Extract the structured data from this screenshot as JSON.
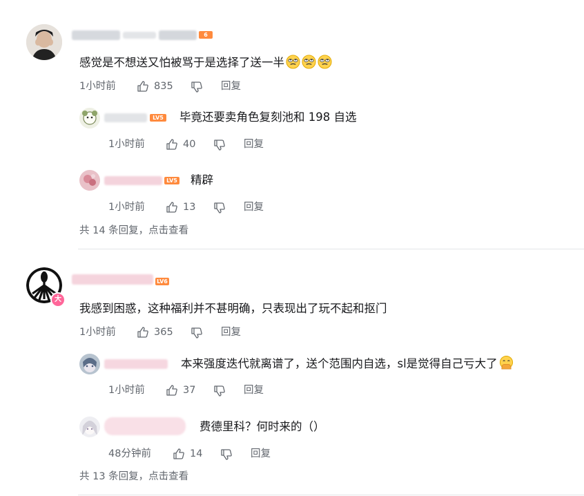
{
  "comments": [
    {
      "level_badge": "6",
      "content": "感觉是不想送又怕被骂于是选择了送一半",
      "emojis": [
        "rolling-eyes",
        "rolling-eyes",
        "rolling-eyes"
      ],
      "time": "1小时前",
      "likes": "835",
      "reply_label": "回复",
      "replies": [
        {
          "level_badge": "LV5",
          "content": "毕竟还要卖角色复刻池和 198 自选",
          "time": "1小时前",
          "likes": "40",
          "reply_label": "回复"
        },
        {
          "level_badge": "LV5",
          "content": "精辟",
          "time": "1小时前",
          "likes": "13",
          "reply_label": "回复"
        }
      ],
      "more_replies": "共 14 条回复，点击查看"
    },
    {
      "level_badge": "LV6",
      "avatar_badge": "大",
      "content": "我感到困惑，这种福利并不甚明确，只表现出了玩不起和抠门",
      "time": "1小时前",
      "likes": "365",
      "reply_label": "回复",
      "replies": [
        {
          "content": "本来强度迭代就离谱了，送个范围内自选，sl是觉得自己亏大了",
          "emoji": "face-with-hand-over-mouth",
          "time": "1小时前",
          "likes": "37",
          "reply_label": "回复"
        },
        {
          "content": "费德里科？何时来的（）",
          "time": "48分钟前",
          "likes": "14",
          "reply_label": "回复"
        }
      ],
      "more_replies": "共 13 条回复，点击查看"
    }
  ],
  "colors": {
    "text": "#18191c",
    "meta": "#61666d",
    "divider": "#e3e5e7",
    "level_orange": "#ff8a3d",
    "avatar_badge": "#ff6699"
  }
}
